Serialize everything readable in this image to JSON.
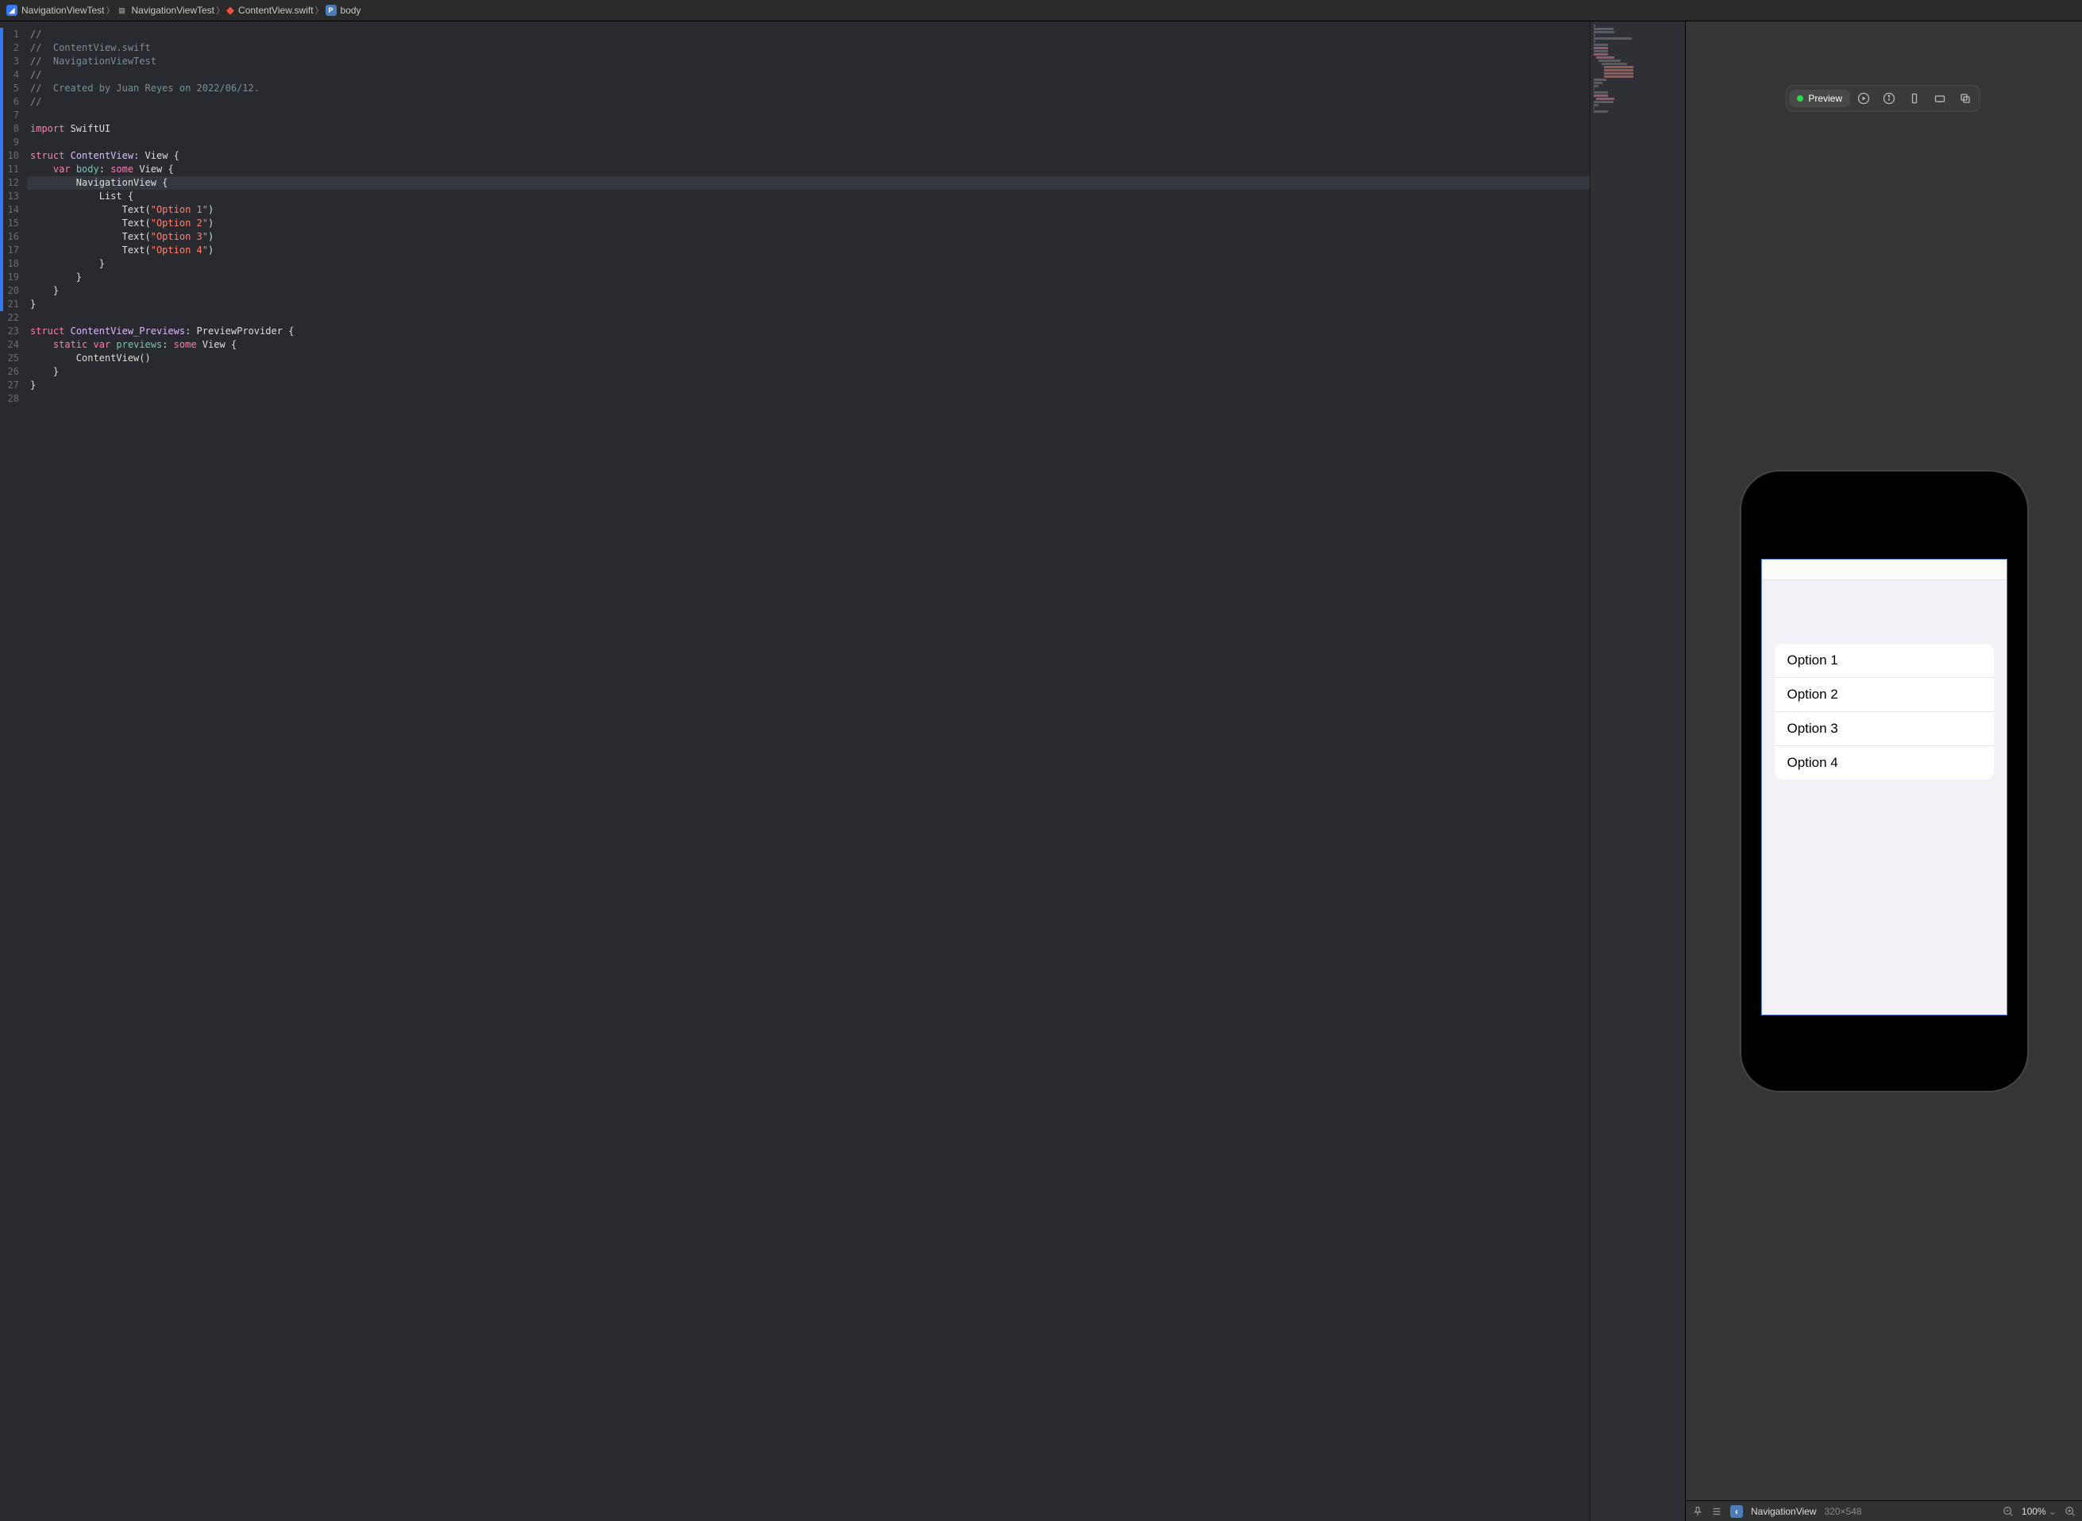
{
  "breadcrumb": {
    "project": "NavigationViewTest",
    "folder": "NavigationViewTest",
    "file": "ContentView.swift",
    "symbol": "body"
  },
  "code": {
    "lines": [
      {
        "n": 1,
        "type": "comment",
        "text": "//"
      },
      {
        "n": 2,
        "type": "comment",
        "text": "//  ContentView.swift"
      },
      {
        "n": 3,
        "type": "comment",
        "text": "//  NavigationViewTest"
      },
      {
        "n": 4,
        "type": "comment",
        "text": "//"
      },
      {
        "n": 5,
        "type": "comment",
        "text": "//  Created by Juan Reyes on 2022/06/12."
      },
      {
        "n": 6,
        "type": "comment",
        "text": "//"
      },
      {
        "n": 7,
        "type": "blank",
        "text": ""
      },
      {
        "n": 8,
        "type": "import",
        "keyword": "import",
        "module": "SwiftUI"
      },
      {
        "n": 9,
        "type": "blank",
        "text": ""
      },
      {
        "n": 10,
        "type": "struct",
        "keyword": "struct",
        "name": "ContentView",
        "proto": "View",
        "suffix": " {"
      },
      {
        "n": 11,
        "type": "var",
        "indent": "    ",
        "kw1": "var",
        "name": "body",
        "colon": ": ",
        "kw2": "some",
        "typ": "View",
        "suffix": " {"
      },
      {
        "n": 12,
        "type": "call",
        "indent": "        ",
        "name": "NavigationView",
        "suffix": " {",
        "highlighted": true
      },
      {
        "n": 13,
        "type": "call",
        "indent": "            ",
        "name": "List",
        "suffix": " {"
      },
      {
        "n": 14,
        "type": "textcall",
        "indent": "                ",
        "fn": "Text",
        "str": "\"Option 1\""
      },
      {
        "n": 15,
        "type": "textcall",
        "indent": "                ",
        "fn": "Text",
        "str": "\"Option 2\""
      },
      {
        "n": 16,
        "type": "textcall",
        "indent": "                ",
        "fn": "Text",
        "str": "\"Option 3\""
      },
      {
        "n": 17,
        "type": "textcall",
        "indent": "                ",
        "fn": "Text",
        "str": "\"Option 4\""
      },
      {
        "n": 18,
        "type": "plain",
        "text": "            }"
      },
      {
        "n": 19,
        "type": "plain",
        "text": "        }"
      },
      {
        "n": 20,
        "type": "plain",
        "text": "    }"
      },
      {
        "n": 21,
        "type": "plain",
        "text": "}"
      },
      {
        "n": 22,
        "type": "blank",
        "text": ""
      },
      {
        "n": 23,
        "type": "struct",
        "keyword": "struct",
        "name": "ContentView_Previews",
        "proto": "PreviewProvider",
        "suffix": " {"
      },
      {
        "n": 24,
        "type": "staticvar",
        "indent": "    ",
        "kw1": "static",
        "kw2": "var",
        "name": "previews",
        "colon": ": ",
        "kw3": "some",
        "typ": "View",
        "suffix": " {"
      },
      {
        "n": 25,
        "type": "plain",
        "text": "        ContentView()"
      },
      {
        "n": 26,
        "type": "plain",
        "text": "    }"
      },
      {
        "n": 27,
        "type": "plain",
        "text": "}"
      },
      {
        "n": 28,
        "type": "blank",
        "text": ""
      }
    ]
  },
  "preview": {
    "label": "Preview",
    "list_items": [
      "Option 1",
      "Option 2",
      "Option 3",
      "Option 4"
    ]
  },
  "bottom": {
    "view_name": "NavigationView",
    "dimensions": "320×548",
    "zoom": "100%"
  }
}
